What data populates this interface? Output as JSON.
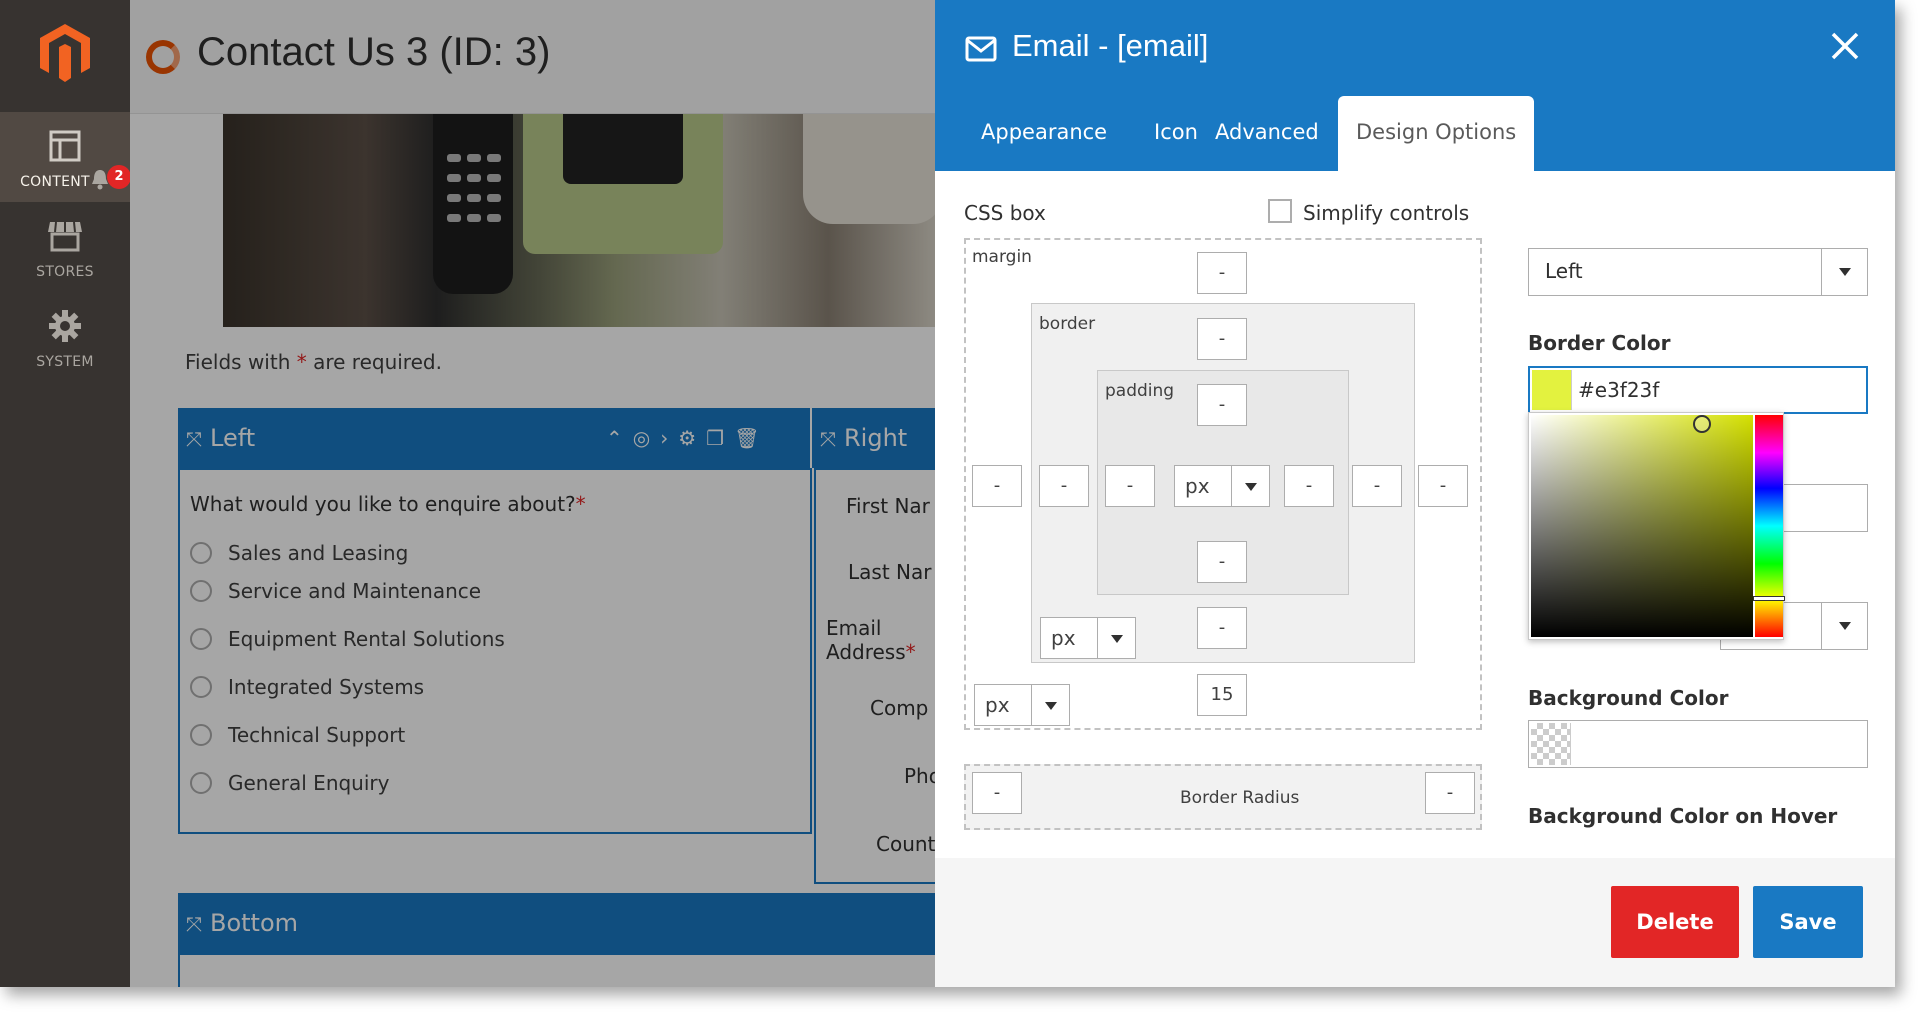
{
  "nav": {
    "items": [
      {
        "label": "CONTENT",
        "icon": "content-icon"
      },
      {
        "label": "STORES",
        "icon": "stores-icon"
      },
      {
        "label": "SYSTEM",
        "icon": "gear-icon"
      }
    ],
    "notification_count": "2"
  },
  "page": {
    "title": "Contact Us 3 (ID: 3)",
    "fields_required_pre": "Fields with ",
    "fields_required_star": "*",
    "fields_required_post": " are required.",
    "left_column": {
      "title": "Left",
      "question": "What would you like to enquire about?",
      "question_star": "*",
      "options": [
        "Sales and Leasing",
        "Service and Maintenance",
        "Equipment Rental Solutions",
        "Integrated Systems",
        "Technical Support",
        "General Enquiry"
      ]
    },
    "right_column": {
      "title": "Right",
      "fields": [
        "First Nar",
        "Last Nar",
        "Email",
        "Address",
        "Comp",
        "Pho",
        "Count"
      ],
      "email_star": "*"
    },
    "bottom_column": {
      "title": "Bottom"
    }
  },
  "modal": {
    "title": "Email - [email]",
    "tabs": [
      "Appearance",
      "Icon",
      "Advanced",
      "Design Options"
    ],
    "active_tab": "Design Options",
    "css_box_label": "CSS box",
    "simplify_label": "Simplify controls",
    "margin_label": "margin",
    "border_label": "border",
    "padding_label": "padding",
    "values": {
      "margin_top": "-",
      "margin_left": "-",
      "margin_right": "-",
      "margin_bottom": "15",
      "border_top": "-",
      "border_left": "-",
      "border_right": "-",
      "border_bottom": "-",
      "padding_top": "-",
      "padding_left": "-",
      "padding_right": "-",
      "padding_bottom": "-"
    },
    "units": {
      "padding": "px",
      "border": "px",
      "margin": "px"
    },
    "border_radius_label": "Border Radius",
    "border_radius_left": "-",
    "border_radius_right": "-",
    "alignment_value": "Left",
    "border_color_label": "Border Color",
    "border_color_value": "#e3f23f",
    "background_color_label": "Background Color",
    "background_hover_label": "Background Color on Hover",
    "delete_label": "Delete",
    "save_label": "Save"
  },
  "colors": {
    "accent": "#1979c3",
    "danger": "#e22626",
    "nav_bg": "#373330",
    "border_color_swatch": "#e3f23f"
  }
}
